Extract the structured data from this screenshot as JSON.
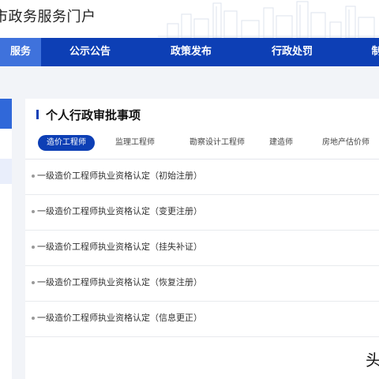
{
  "header": {
    "portal_title": "市政务服务门户"
  },
  "nav": {
    "items": [
      {
        "label": "服务"
      },
      {
        "label": "公示公告"
      },
      {
        "label": "政策发布"
      },
      {
        "label": "行政处罚"
      },
      {
        "label": "制"
      }
    ]
  },
  "section": {
    "title": "个人行政审批事项",
    "tabs": [
      {
        "label": "造价工程师"
      },
      {
        "label": "监理工程师"
      },
      {
        "label": "勘察设计工程师"
      },
      {
        "label": "建造师"
      },
      {
        "label": "房地产估价师"
      }
    ],
    "items": [
      {
        "text": "一级造价工程师执业资格认定（初始注册）"
      },
      {
        "text": "一级造价工程师执业资格认定（变更注册）"
      },
      {
        "text": "一级造价工程师执业资格认定（挂失补证）"
      },
      {
        "text": "一级造价工程师执业资格认定（恢复注册）"
      },
      {
        "text": "一级造价工程师执业资格认定（信息更正）"
      }
    ]
  },
  "watermark": "头",
  "colors": {
    "nav_bg": "#0d3fb5",
    "nav_active": "#3f72dc",
    "accent": "#0d3fb5",
    "page_bg": "#f2f4f8"
  }
}
